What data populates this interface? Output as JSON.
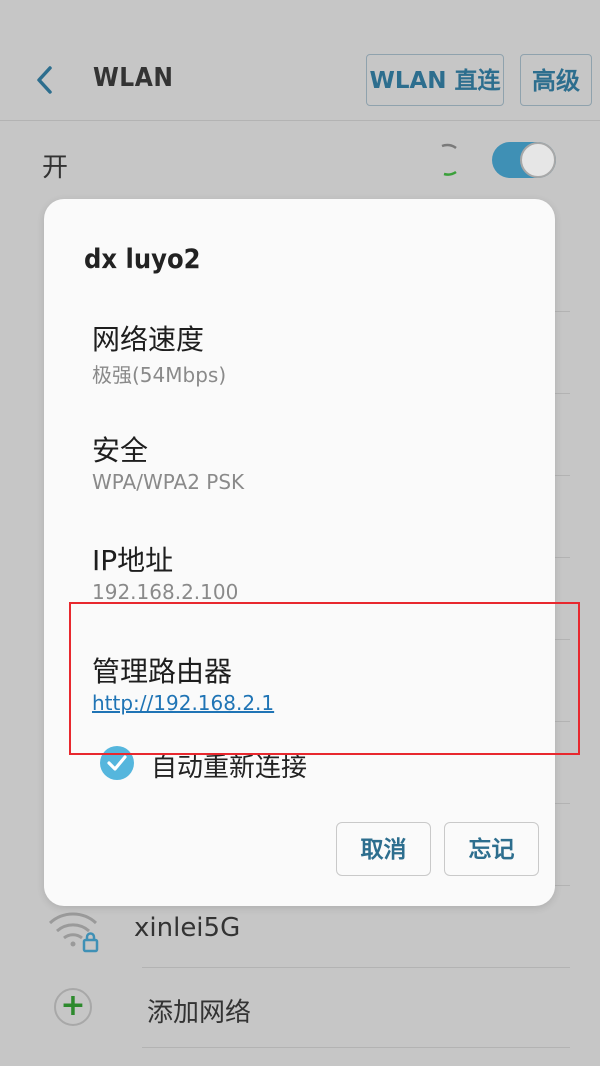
{
  "appbar": {
    "title": "WLAN",
    "direct_button": "WLAN 直连",
    "advanced_button": "高级"
  },
  "wifi_switch": {
    "label": "开",
    "state": "on"
  },
  "networks": [
    {
      "name": "xinlei5G",
      "icon": "wifi-locked-icon"
    }
  ],
  "add_network": {
    "label": "添加网络",
    "icon": "plus-icon"
  },
  "dialog": {
    "title": "dx luyo2",
    "speed": {
      "label": "网络速度",
      "value": "极强(54Mbps)"
    },
    "security": {
      "label": "安全",
      "value": "WPA/WPA2 PSK"
    },
    "ip": {
      "label": "IP地址",
      "value": "192.168.2.100"
    },
    "router": {
      "label": "管理路由器",
      "link": "http://192.168.2.1"
    },
    "auto_reconnect": {
      "label": "自动重新连接",
      "checked": true
    },
    "cancel_label": "取消",
    "forget_label": "忘记"
  },
  "colors": {
    "accent": "#2d6e8e",
    "toggle_on": "#3f90b5",
    "checkbox": "#55b6dd",
    "link": "#1f74b5",
    "annotation": "#e8282e"
  }
}
